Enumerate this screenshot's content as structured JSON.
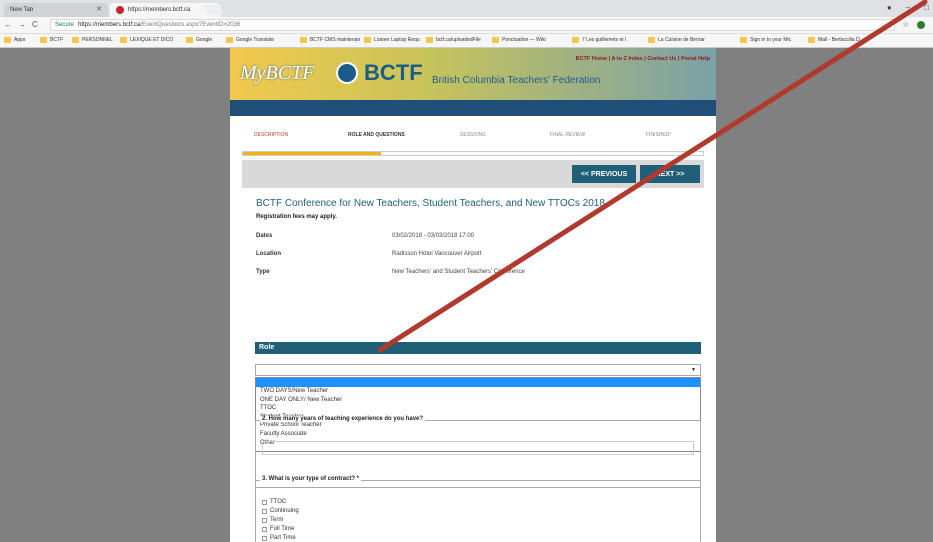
{
  "browser": {
    "tab1": "New Tab",
    "tab2": "https://members.bctf.ca",
    "url_security": "Secure",
    "url_domain": "https://members.bctf.ca",
    "url_path": "/EventQuestions.aspx?EventID=2036",
    "bookmarks": [
      "Apps",
      "BCTF",
      "PERSONNEL",
      "LEXIQUE ET DICO",
      "Google",
      "Google Translate",
      "BCTF CMS maintenan",
      "Loaner Laptop Requ",
      "bctf.ca/uploadedFile",
      "Ponctuation — Wiki",
      "7 Les guillemets et l",
      "La Cuisine de Bernar",
      "Sign in to your Mic",
      "Mail - Bertaccilia D"
    ]
  },
  "header": {
    "links": "BCTF Home | A to Z Index | Contact Us | Portal Help",
    "logo_my": "MyBCTF",
    "logo_bctf": "BCTF",
    "logo_full": "British Columbia Teachers' Federation"
  },
  "steps": [
    "DESCRIPTION",
    "ROLE AND QUESTIONS",
    "SESSIONS",
    "FINAL REVIEW",
    "FINISHED!"
  ],
  "progress": 0.3,
  "nav": {
    "previous": "<< PREVIOUS",
    "next": "NEXT >>"
  },
  "event": {
    "title": "BCTF Conference for New Teachers, Student Teachers, and New TTOCs 2018",
    "fees": "Registration fees may apply.",
    "dates_label": "Dates",
    "dates": "03/02/2018 - 03/03/2018 17:00",
    "location_label": "Location",
    "location": "Radisson Hotel Vancouver Airport",
    "type_label": "Type",
    "type": "New Teachers' and Student Teachers' Conference"
  },
  "role": {
    "header": "Role",
    "options": [
      "TWO DAYS/New Teacher",
      "ONE DAY ONLY/ New Teacher",
      "TTOC",
      "Student Teacher",
      "Private School Teacher",
      "Faculty Associate",
      "Other"
    ]
  },
  "q2": {
    "label": "2. How many years of teaching experience do you have?"
  },
  "q3": {
    "label": "3. What is your type of contract? *",
    "options": [
      "TTOC",
      "Continuing",
      "Term",
      "Full Time",
      "Part Time"
    ]
  },
  "colors": {
    "accent": "#1f5f78",
    "progress": "#f2b400",
    "annotation": "#c0392b"
  }
}
